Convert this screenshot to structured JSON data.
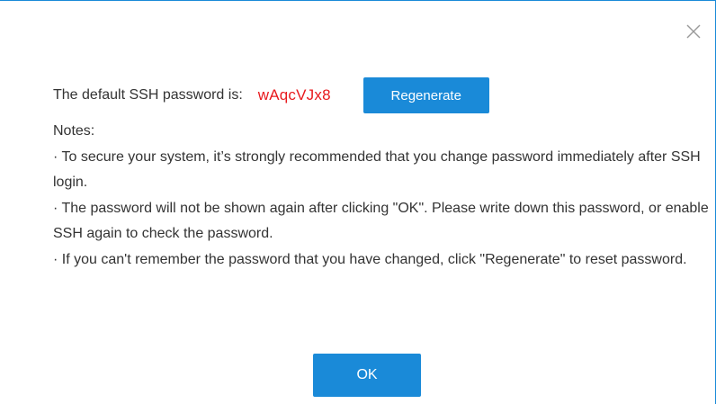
{
  "dialog": {
    "close_icon": "close-icon",
    "password_label": "The default SSH password is:",
    "password_value": "wAqcVJx8",
    "regenerate_label": "Regenerate",
    "notes_title": "Notes:",
    "notes": [
      "· To secure your system, it’s strongly recommended that you change password immediately after SSH login.",
      "· The password will not be shown again after clicking \"OK\". Please write down this password, or enable SSH again to check the password.",
      "· If you can't remember the password that you have changed, click \"Regenerate\" to reset password."
    ],
    "ok_label": "OK"
  },
  "colors": {
    "accent": "#1a8ad8",
    "password": "#e8191d",
    "text": "#333333"
  }
}
